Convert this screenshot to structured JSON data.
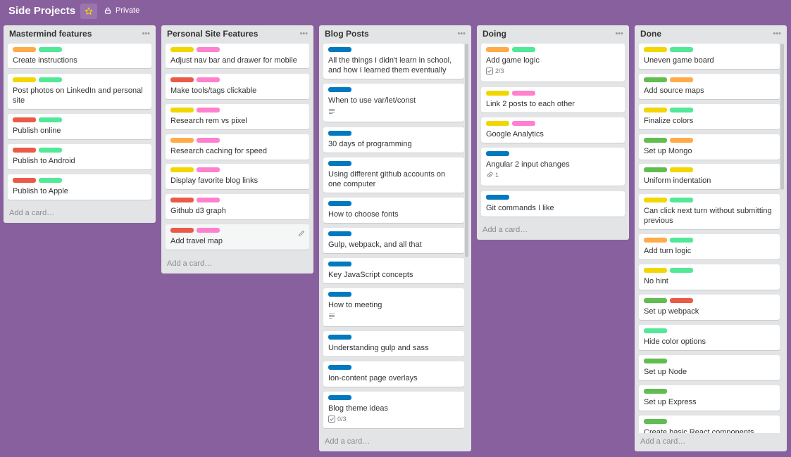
{
  "board": {
    "title": "Side Projects",
    "privacy": "Private"
  },
  "add_card_label": "Add a card…",
  "lists": [
    {
      "title": "Mastermind features",
      "cards": [
        {
          "labels": [
            "orange",
            "mint"
          ],
          "title": "Create instructions"
        },
        {
          "labels": [
            "yellow",
            "mint"
          ],
          "title": "Post photos on LinkedIn and personal site"
        },
        {
          "labels": [
            "red",
            "mint"
          ],
          "title": "Publish online"
        },
        {
          "labels": [
            "red",
            "mint"
          ],
          "title": "Publish to Android"
        },
        {
          "labels": [
            "red",
            "mint"
          ],
          "title": "Publish to Apple"
        }
      ]
    },
    {
      "title": "Personal Site Features",
      "cards": [
        {
          "labels": [
            "yellow",
            "pink"
          ],
          "title": "Adjust nav bar and drawer for mobile"
        },
        {
          "labels": [
            "red",
            "pink"
          ],
          "title": "Make tools/tags clickable"
        },
        {
          "labels": [
            "yellow",
            "pink"
          ],
          "title": "Research rem vs pixel"
        },
        {
          "labels": [
            "orange",
            "pink"
          ],
          "title": "Research caching for speed"
        },
        {
          "labels": [
            "yellow",
            "pink"
          ],
          "title": "Display favorite blog links"
        },
        {
          "labels": [
            "red",
            "pink"
          ],
          "title": "Github d3 graph"
        },
        {
          "labels": [
            "red",
            "pink"
          ],
          "title": "Add travel map"
        }
      ]
    },
    {
      "title": "Blog Posts",
      "cards": [
        {
          "labels": [
            "blue"
          ],
          "title": "All the things I didn't learn in school, and how I learned them eventually"
        },
        {
          "labels": [
            "blue"
          ],
          "title": "When to use var/let/const",
          "badge_description": true
        },
        {
          "labels": [
            "blue"
          ],
          "title": "30 days of programming"
        },
        {
          "labels": [
            "blue"
          ],
          "title": "Using different github accounts on one computer"
        },
        {
          "labels": [
            "blue"
          ],
          "title": "How to choose fonts"
        },
        {
          "labels": [
            "blue"
          ],
          "title": "Gulp, webpack, and all that"
        },
        {
          "labels": [
            "blue"
          ],
          "title": "Key JavaScript concepts"
        },
        {
          "labels": [
            "blue"
          ],
          "title": "How to meeting",
          "badge_description": true
        },
        {
          "labels": [
            "blue"
          ],
          "title": "Understanding gulp and sass"
        },
        {
          "labels": [
            "blue"
          ],
          "title": "Ion-content page overlays"
        },
        {
          "labels": [
            "blue"
          ],
          "title": "Blog theme ideas",
          "badge_checklist": "0/3"
        }
      ]
    },
    {
      "title": "Doing",
      "cards": [
        {
          "labels": [
            "orange",
            "mint"
          ],
          "title": "Add game logic",
          "badge_checklist": "2/3"
        },
        {
          "labels": [
            "yellow",
            "pink"
          ],
          "title": "Link 2 posts to each other"
        },
        {
          "labels": [
            "yellow",
            "pink"
          ],
          "title": "Google Analytics"
        },
        {
          "labels": [
            "blue"
          ],
          "title": "Angular 2 input changes",
          "badge_attachment": "1"
        },
        {
          "labels": [
            "blue"
          ],
          "title": "Git commands I like"
        }
      ]
    },
    {
      "title": "Done",
      "cards": [
        {
          "labels": [
            "yellow",
            "mint"
          ],
          "title": "Uneven game board"
        },
        {
          "labels": [
            "green",
            "orange"
          ],
          "title": "Add source maps"
        },
        {
          "labels": [
            "yellow",
            "mint"
          ],
          "title": "Finalize colors"
        },
        {
          "labels": [
            "green",
            "orange"
          ],
          "title": "Set up Mongo"
        },
        {
          "labels": [
            "green",
            "yellow"
          ],
          "title": "Uniform indentation"
        },
        {
          "labels": [
            "yellow",
            "mint"
          ],
          "title": "Can click next turn without submitting previous"
        },
        {
          "labels": [
            "orange",
            "mint"
          ],
          "title": "Add turn logic"
        },
        {
          "labels": [
            "yellow",
            "mint"
          ],
          "title": "No hint"
        },
        {
          "labels": [
            "green",
            "red"
          ],
          "title": "Set up webpack"
        },
        {
          "labels": [
            "mint"
          ],
          "title": "Hide color options"
        },
        {
          "labels": [
            "green"
          ],
          "title": "Set up Node"
        },
        {
          "labels": [
            "green"
          ],
          "title": "Set up Express"
        },
        {
          "labels": [
            "green"
          ],
          "title": "Create basic React components"
        }
      ]
    }
  ],
  "colors": {
    "board_background": "#89609e",
    "list_background": "#e2e4e6",
    "green": "#61bd4f",
    "yellow": "#f2d600",
    "orange": "#ffab4a",
    "red": "#eb5a46",
    "blue": "#0079bf",
    "pink": "#ff80ce",
    "mint": "#51e898"
  }
}
